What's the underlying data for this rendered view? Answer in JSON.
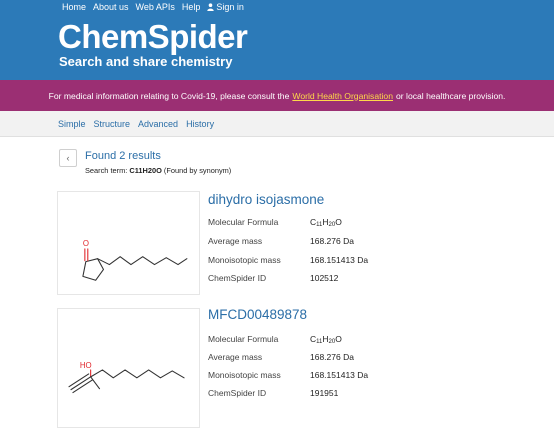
{
  "topnav": {
    "home": "Home",
    "about": "About us",
    "webapis": "Web APIs",
    "help": "Help",
    "signin": "Sign in"
  },
  "brand": {
    "logo": "ChemSpider",
    "tagline": "Search and share chemistry"
  },
  "banner": {
    "text_before": "For medical information relating to Covid-19, please consult the",
    "link": "World Health Organisation",
    "text_after": "or local healthcare provision."
  },
  "searchnav": {
    "simple": "Simple",
    "structure": "Structure",
    "advanced": "Advanced",
    "history": "History"
  },
  "results": {
    "back_glyph": "‹",
    "found": "Found 2 results",
    "term_label": "Search term:",
    "term_value": "C11H20O",
    "term_note": "(Found by synonym)"
  },
  "compounds": [
    {
      "name": "dihydro isojasmone",
      "formula_label": "Molecular Formula",
      "formula": {
        "c": "C",
        "c_n": "11",
        "h": "H",
        "h_n": "20",
        "o": "O"
      },
      "avg_mass_label": "Average mass",
      "avg_mass": "168.276 Da",
      "mono_mass_label": "Monoisotopic mass",
      "mono_mass": "168.151413 Da",
      "csid_label": "ChemSpider ID",
      "csid": "102512",
      "atom_label": "O"
    },
    {
      "name": "MFCD00489878",
      "formula_label": "Molecular Formula",
      "formula": {
        "c": "C",
        "c_n": "11",
        "h": "H",
        "h_n": "20",
        "o": "O"
      },
      "avg_mass_label": "Average mass",
      "avg_mass": "168.276 Da",
      "mono_mass_label": "Monoisotopic mass",
      "mono_mass": "168.151413 Da",
      "csid_label": "ChemSpider ID",
      "csid": "191951",
      "atom_label": "HO"
    }
  ],
  "colors": {
    "header": "#2c7ab8",
    "banner": "#9b2f73",
    "link": "#2b6ea7",
    "banner_link": "#ffd84a",
    "heteroatom": "#e0262b"
  }
}
